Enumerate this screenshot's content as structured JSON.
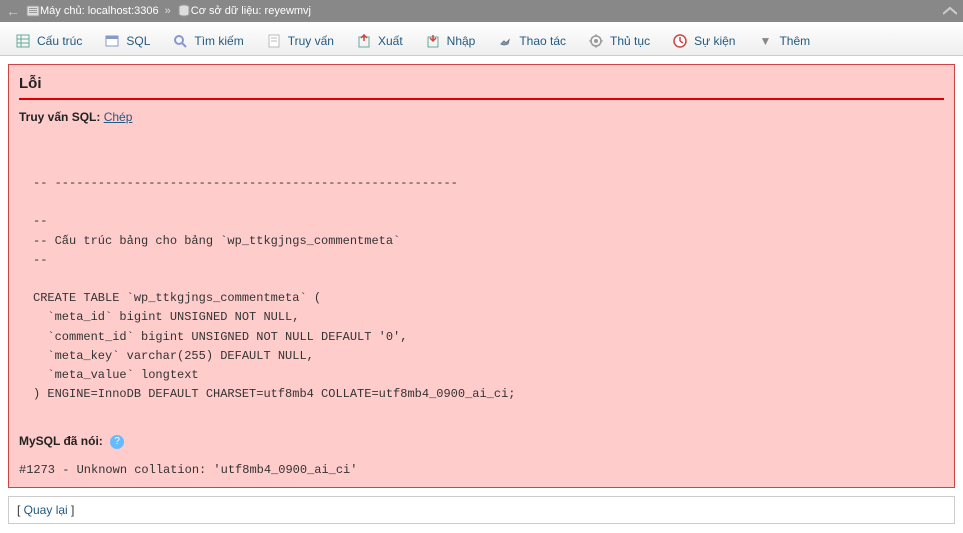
{
  "topbar": {
    "server_prefix": "Máy chủ:",
    "server_value": "localhost:3306",
    "db_prefix": "Cơ sở dữ liệu:",
    "db_value": "reyewmvj"
  },
  "tabs": {
    "structure": "Cấu trúc",
    "sql": "SQL",
    "search": "Tìm kiếm",
    "query": "Truy vấn",
    "export": "Xuất",
    "import": "Nhập",
    "operations": "Thao tác",
    "routines": "Thủ tục",
    "events": "Sự kiện",
    "more": "Thêm"
  },
  "error": {
    "title": "Lỗi",
    "query_label": "Truy vấn SQL:",
    "copy": "Chép",
    "sql": "-- --------------------------------------------------------\n\n--\n-- Cấu trúc bảng cho bảng `wp_ttkgjngs_commentmeta`\n--\n\nCREATE TABLE `wp_ttkgjngs_commentmeta` (\n  `meta_id` bigint UNSIGNED NOT NULL,\n  `comment_id` bigint UNSIGNED NOT NULL DEFAULT '0',\n  `meta_key` varchar(255) DEFAULT NULL,\n  `meta_value` longtext\n) ENGINE=InnoDB DEFAULT CHARSET=utf8mb4 COLLATE=utf8mb4_0900_ai_ci;",
    "mysql_said": "MySQL đã nói:",
    "message": "#1273 - Unknown collation: 'utf8mb4_0900_ai_ci'"
  },
  "back": {
    "label": "Quay lại"
  }
}
